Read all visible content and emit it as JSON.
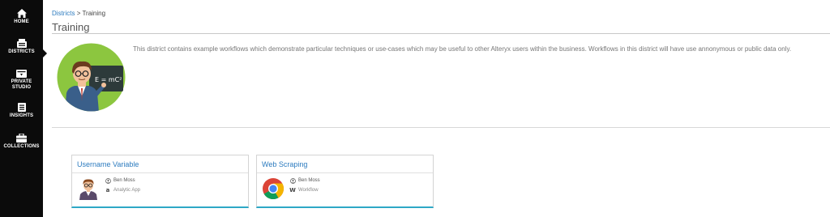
{
  "sidebar": {
    "items": [
      {
        "label": "HOME",
        "icon": "home-icon"
      },
      {
        "label": "DISTRICTS",
        "icon": "districts-icon"
      },
      {
        "label": "PRIVATE STUDIO",
        "line1": "PRIVATE",
        "line2": "STUDIO",
        "icon": "private-studio-icon"
      },
      {
        "label": "INSIGHTS",
        "icon": "insights-icon"
      },
      {
        "label": "COLLECTIONS",
        "icon": "collections-icon"
      }
    ],
    "active": "DISTRICTS"
  },
  "breadcrumb": {
    "parent": "Districts",
    "separator": ">",
    "current": "Training"
  },
  "page": {
    "title": "Training",
    "description": "This district contains example workflows which demonstrate particular techniques or use-cases which may be useful to other Alteryx users within the business. Workflows in this district will have use annonymous or public data only.",
    "image_icon": "teacher-avatar-icon",
    "image_text": "E = mC²"
  },
  "cards": [
    {
      "title": "Username Variable",
      "author": "Ben Moss",
      "type_glyph": "a",
      "type": "Analytic App",
      "thumb_icon": "scientist-avatar-icon"
    },
    {
      "title": "Web Scraping",
      "author": "Ben Moss",
      "type_glyph": "W",
      "type": "Workflow",
      "thumb_icon": "chrome-logo-icon"
    }
  ],
  "colors": {
    "sidebar_bg": "#0b0b0b",
    "link": "#2c7bbf",
    "card_accent": "#2ea8c6",
    "avatar_bg": "#8cc63f"
  }
}
